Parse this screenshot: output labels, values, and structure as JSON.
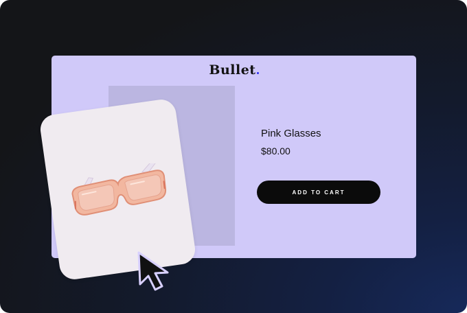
{
  "brand": {
    "logo_text": "Bullet",
    "dot_color": "#2c2cf0"
  },
  "product": {
    "name": "Pink Glasses",
    "price": "$80.00",
    "image_icon": "sunglasses-icon"
  },
  "cta": {
    "label": "ADD TO CART"
  },
  "pointer": {
    "icon": "cursor-arrow-icon"
  },
  "colors": {
    "card_background": "#d0c9f9",
    "image_placeholder": "#bbb6e1",
    "button_background": "#0b0b0b",
    "button_text": "#ffffff",
    "photo_card": "#f0ebf0"
  }
}
